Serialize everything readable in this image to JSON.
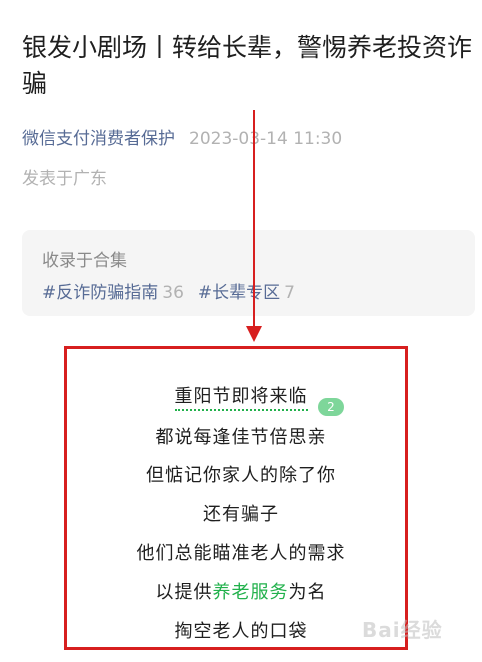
{
  "article": {
    "title": "银发小剧场丨转给长辈，警惕养老投资诈骗",
    "account": "微信支付消费者保护",
    "time": "2023-03-14 11:30",
    "location": "发表于广东"
  },
  "collection": {
    "label": "收录于合集",
    "tags": [
      {
        "name": "#反诈防骗指南",
        "count": "36"
      },
      {
        "name": "#长辈专区",
        "count": "7"
      }
    ]
  },
  "content": {
    "lines": [
      "重阳节即将来临",
      "都说每逢佳节倍思亲",
      "但惦记你家人的除了你",
      "还有骗子",
      "他们总能瞄准老人的需求"
    ],
    "line6_prefix": "以提供",
    "line6_highlight": "养老服务",
    "line6_suffix": "为名",
    "line7": "掏空老人的口袋",
    "comment_count": "2"
  },
  "watermark": "Bai经验",
  "colors": {
    "accent_red": "#d71f1f",
    "link_blue": "#576b95",
    "green": "#22b14c"
  }
}
